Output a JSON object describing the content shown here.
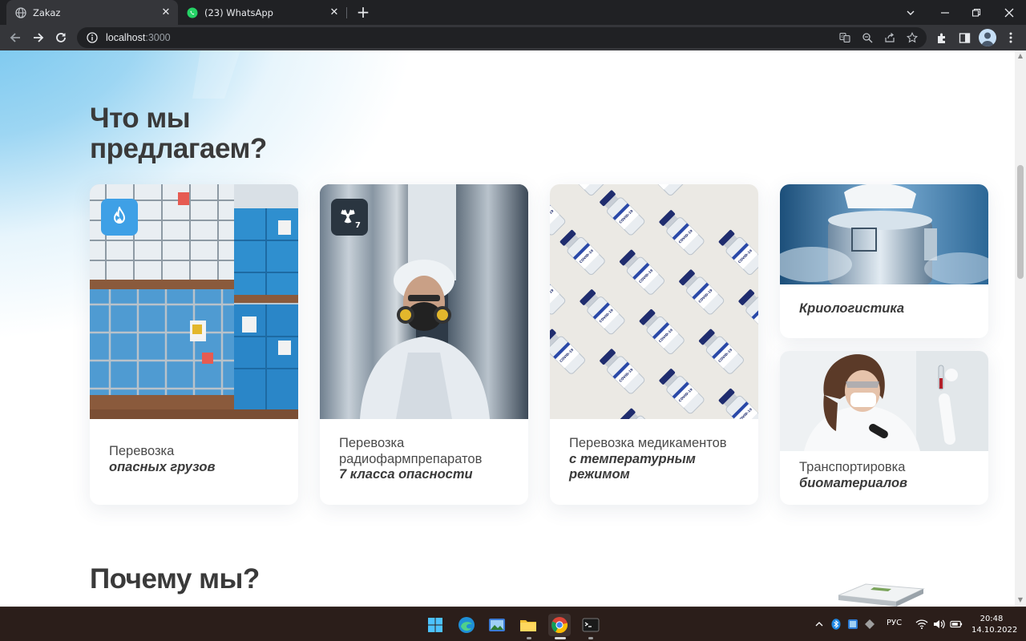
{
  "browser": {
    "tabs": [
      {
        "title": "Zakaz",
        "icon": "globe-icon",
        "active": true
      },
      {
        "title": "(23) WhatsApp",
        "icon": "whatsapp-icon",
        "active": false
      }
    ],
    "url_host": "localhost",
    "url_port": ":3000"
  },
  "page": {
    "offer_title_line1": "Что мы",
    "offer_title_line2": "предлагаем?",
    "cards": [
      {
        "line1": "Перевозка",
        "emphasis": "опасных грузов",
        "badge": "flame-icon"
      },
      {
        "line1": "Перевозка",
        "line2": "радиофармпрепаратов",
        "emphasis": "7 класса опасности",
        "badge": "radiation-icon",
        "badge_number": "7"
      },
      {
        "line1": "Перевозка медикаментов",
        "emphasis_line1": "с температурным",
        "emphasis_line2": "режимом",
        "vial_label": "COVID-19"
      },
      {
        "emphasis": "Криологистика"
      },
      {
        "line1": "Транспортировка",
        "emphasis": "биоматериалов"
      }
    ],
    "why_title": "Почему мы?"
  },
  "taskbar": {
    "language": "РУС",
    "time": "20:48",
    "date": "14.10.2022"
  },
  "colors": {
    "accent_blue": "#3ea0e6",
    "heading": "#3a3a3a",
    "text": "#4a4a4a"
  }
}
